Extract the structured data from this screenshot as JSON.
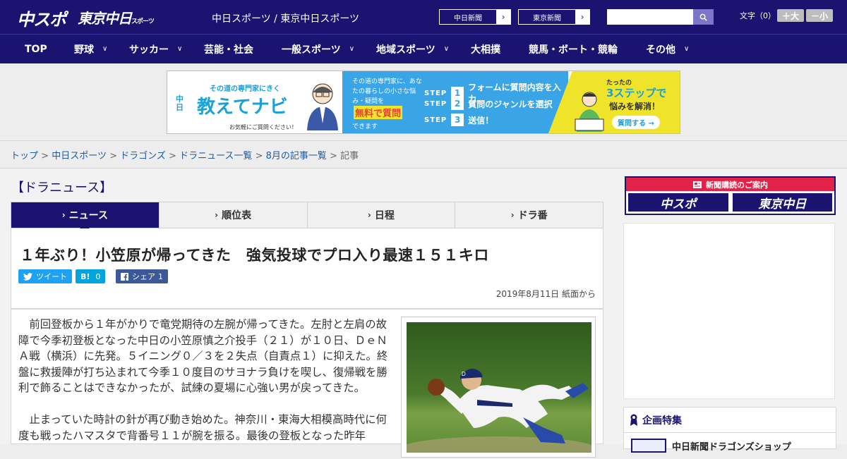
{
  "header": {
    "logo_chuspo": "中スポ",
    "logo_tokyo": "東京中日",
    "logo_tokyo_small": "スポーツ",
    "site_title": "中日スポーツ / 東京中日スポーツ",
    "btn_chunichi": "中日新聞",
    "btn_tokyo": "東京新聞",
    "search_placeholder": "",
    "font_label": "文字（0）",
    "font_larger": "＋大",
    "font_smaller": "－小"
  },
  "nav": {
    "items": [
      "TOP",
      "野球",
      "サッカー",
      "芸能・社会",
      "一般スポーツ",
      "地域スポーツ",
      "大相撲",
      "競馬・ボート・競輪",
      "その他"
    ]
  },
  "banner": {
    "tagline": "その道の専門家にきく",
    "kana": "中日",
    "title": "教えてナビ",
    "ask_note": "お気軽にご質問ください！",
    "mid_text": "その道の専門家に、あなたの暮らしの小さな悩み・疑問を",
    "mid_free": "無料で質問",
    "mid_end": "できます",
    "step_label": "STEP",
    "steps": [
      "フォームに質問内容を入力",
      "質問のジャンルを選択",
      "送信！"
    ],
    "right_small": "たったの",
    "right_big": "3ステップで",
    "right_sub": "悩みを解消！",
    "right_btn": "質問する →"
  },
  "breadcrumb": {
    "items": [
      "トップ",
      "中日スポーツ",
      "ドラゴンズ",
      "ドラニュース一覧",
      "8月の記事一覧"
    ],
    "current": "記事",
    "sep": ">"
  },
  "section_title": "【ドラニュース】",
  "tabs": [
    "ニュース",
    "順位表",
    "日程",
    "ドラ番"
  ],
  "article": {
    "headline": "１年ぶり！小笠原が帰ってきた　強気投球でプロ入り最速１５１キロ",
    "tweet": "ツイート",
    "hatena_label": "B!",
    "hatena_count": "0",
    "share_label": "シェア",
    "share_count": "1",
    "date": "2019年8月11日 紙面から",
    "paragraphs": [
      "前回登板から１年がかりで竜党期待の左腕が帰ってきた。左肘と左肩の故障で今季初登板となった中日の小笠原慎之介投手（２１）が１０日、ＤｅＮＡ戦（横浜）に先発。５イニング０／３を２失点（自責点１）に抑えた。終盤に救援陣が打ち込まれて今季１０度目のサヨナラ負けを喫し、復帰戦を勝利で飾ることはできなかったが、試練の夏場に心強い男が戻ってきた。",
      "止まっていた時計の針が再び動き始めた。神奈川・東海大相模高時代に何度も戦ったハマスタで背番号１１が腕を振る。最後の登板となった昨年"
    ]
  },
  "sidebar": {
    "sub_top": "新聞購読のご案内",
    "sub_logo1": "中スポ",
    "sub_logo2": "東京中日",
    "feature_title": "企画特集",
    "feature_item": "中日新聞ドラゴンズショップ"
  },
  "colors": {
    "navy": "#1a1470",
    "accent_red": "#e3224a",
    "twitter": "#1da1f2",
    "hatena": "#00a4de",
    "facebook": "#3b5998"
  }
}
